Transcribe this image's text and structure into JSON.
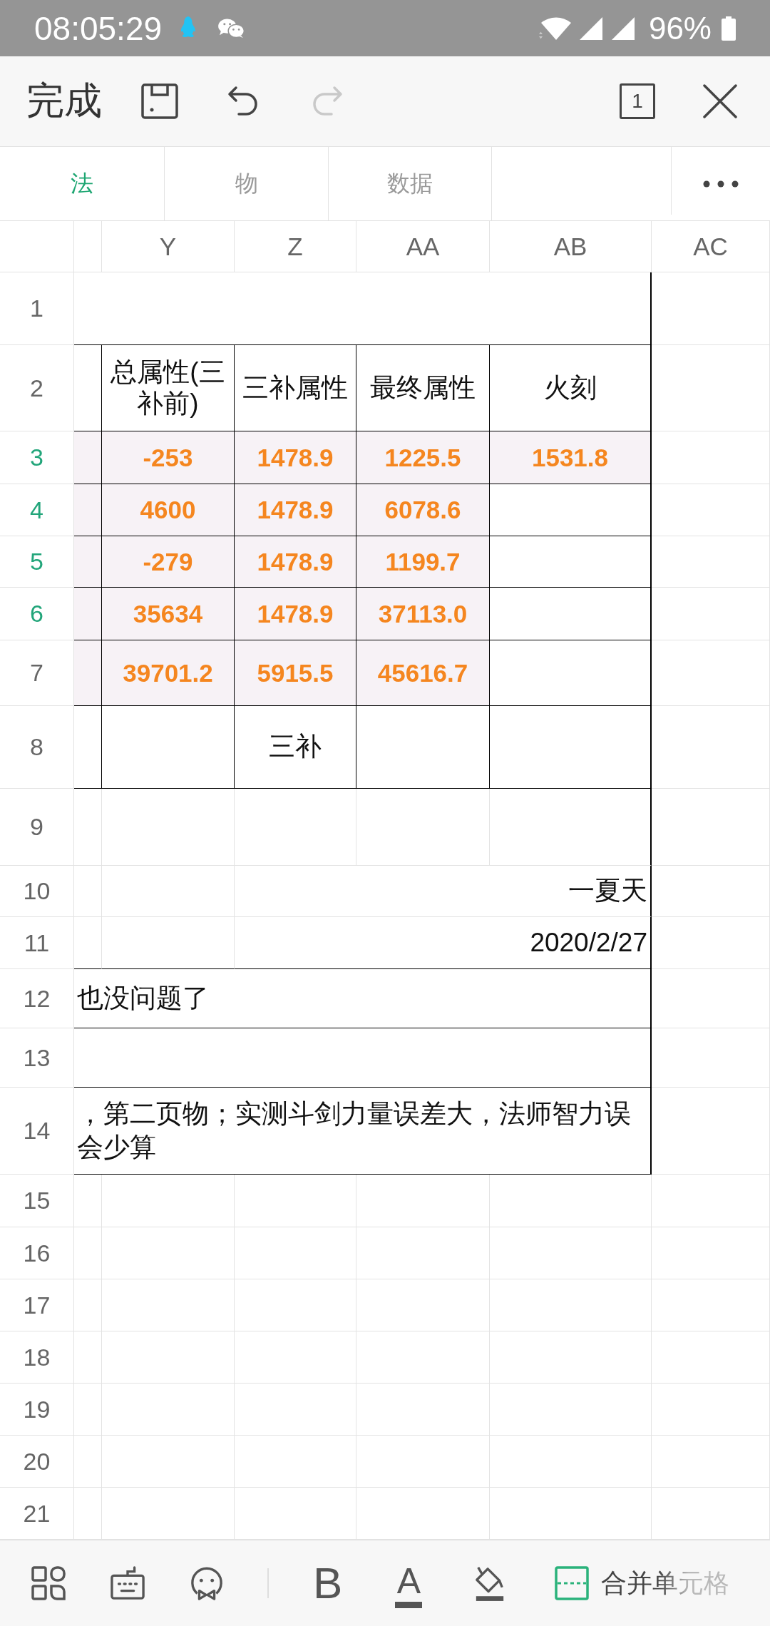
{
  "status_bar": {
    "time": "08:05:29",
    "battery": "96%"
  },
  "toolbar": {
    "done": "完成",
    "actions": [
      {
        "kind": "save",
        "disabled": false
      },
      {
        "kind": "undo",
        "disabled": false
      },
      {
        "kind": "redo",
        "disabled": true
      }
    ],
    "sheet_count": "1"
  },
  "tabs": [
    {
      "label": "法",
      "selected": true
    },
    {
      "label": "物",
      "selected": false
    },
    {
      "label": "数据",
      "selected": false
    }
  ],
  "columns": [
    {
      "label": "Y",
      "selected": false
    },
    {
      "label": "Z",
      "selected": false
    },
    {
      "label": "AA",
      "selected": false
    },
    {
      "label": "AB",
      "selected": false
    },
    {
      "label": "AC",
      "selected": false
    }
  ],
  "rows": [
    {
      "number": "1",
      "selected": false,
      "kind": "title"
    },
    {
      "number": "2",
      "selected": false,
      "kind": "table",
      "cells": [
        {
          "shaded": false
        },
        {
          "text": "总属性(三补前)",
          "kind": "label",
          "shaded": false
        },
        {
          "text": "三补属性",
          "kind": "label",
          "shaded": false
        },
        {
          "text": "最终属性",
          "kind": "label",
          "shaded": false
        },
        {
          "text": "火刻",
          "kind": "label",
          "shaded": false
        }
      ]
    },
    {
      "number": "3",
      "selected": true,
      "kind": "table",
      "cells": [
        {
          "shaded": true
        },
        {
          "text": "-253",
          "kind": "number",
          "shaded": true
        },
        {
          "text": "1478.9",
          "kind": "number",
          "shaded": true
        },
        {
          "text": "1225.5",
          "kind": "number",
          "shaded": true
        },
        {
          "text": "1531.8",
          "kind": "number",
          "shaded": true
        }
      ]
    },
    {
      "number": "4",
      "selected": true,
      "kind": "table",
      "cells": [
        {
          "shaded": true
        },
        {
          "text": "4600",
          "kind": "number",
          "shaded": true
        },
        {
          "text": "1478.9",
          "kind": "number",
          "shaded": true
        },
        {
          "text": "6078.6",
          "kind": "number",
          "shaded": true
        },
        {
          "shaded": false
        }
      ]
    },
    {
      "number": "5",
      "selected": true,
      "kind": "table",
      "cells": [
        {
          "shaded": true
        },
        {
          "text": "-279",
          "kind": "number",
          "shaded": true
        },
        {
          "text": "1478.9",
          "kind": "number",
          "shaded": true
        },
        {
          "text": "1199.7",
          "kind": "number",
          "shaded": true
        },
        {
          "shaded": false
        }
      ]
    },
    {
      "number": "6",
      "selected": true,
      "kind": "table",
      "cells": [
        {
          "shaded": true
        },
        {
          "text": "35634",
          "kind": "number",
          "shaded": true
        },
        {
          "text": "1478.9",
          "kind": "number",
          "shaded": true
        },
        {
          "text": "37113.0",
          "kind": "number",
          "shaded": true
        },
        {
          "shaded": false
        }
      ]
    },
    {
      "number": "7",
      "selected": false,
      "kind": "table",
      "cells": [
        {
          "shaded": true
        },
        {
          "text": "39701.2",
          "kind": "number",
          "shaded": true
        },
        {
          "text": "5915.5",
          "kind": "number",
          "shaded": true
        },
        {
          "text": "45616.7",
          "kind": "number",
          "shaded": true
        },
        {
          "shaded": false
        }
      ]
    },
    {
      "number": "8",
      "selected": false,
      "kind": "table",
      "cells": [
        {
          "shaded": false
        },
        {
          "shaded": false
        },
        {
          "text": "三补",
          "kind": "label",
          "shaded": false
        },
        {
          "shaded": false
        },
        {
          "shaded": false
        }
      ]
    },
    {
      "number": "9",
      "selected": false,
      "kind": "blank"
    },
    {
      "number": "10",
      "selected": false,
      "kind": "signature",
      "text": "一夏天"
    },
    {
      "number": "11",
      "selected": false,
      "kind": "signature",
      "text": "2020/2/27"
    },
    {
      "number": "12",
      "selected": false,
      "kind": "note",
      "text": "也没问题了"
    },
    {
      "number": "13",
      "selected": false,
      "kind": "note"
    },
    {
      "number": "14",
      "selected": false,
      "kind": "note",
      "text": "，第二页物；实测斗剑力量误差大，法师智力误会少算"
    },
    {
      "number": "15",
      "selected": false,
      "kind": "empty"
    },
    {
      "number": "16",
      "selected": false,
      "kind": "empty"
    },
    {
      "number": "17",
      "selected": false,
      "kind": "empty"
    },
    {
      "number": "18",
      "selected": false,
      "kind": "empty"
    },
    {
      "number": "19",
      "selected": false,
      "kind": "empty"
    },
    {
      "number": "20",
      "selected": false,
      "kind": "empty"
    },
    {
      "number": "21",
      "selected": false,
      "kind": "empty"
    }
  ],
  "bottom_bar": {
    "tools": [
      {
        "kind": "apps"
      },
      {
        "kind": "keyboard"
      },
      {
        "kind": "emoji"
      }
    ],
    "format": [
      {
        "kind": "bold",
        "label": "B"
      },
      {
        "kind": "font-color",
        "label": "A"
      },
      {
        "kind": "fill-color"
      },
      {
        "kind": "merge",
        "label": "合并单元格"
      }
    ]
  }
}
